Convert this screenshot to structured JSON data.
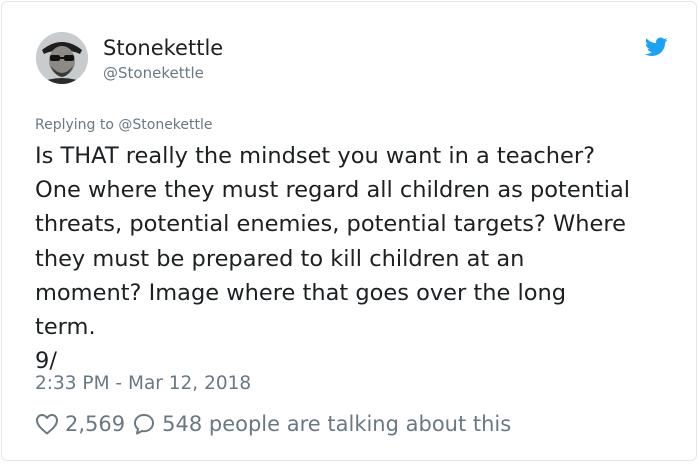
{
  "author": {
    "name": "Stonekettle",
    "handle": "@Stonekettle",
    "avatar_icon": "author-avatar-photo"
  },
  "brand": {
    "icon": "twitter-bird-icon",
    "color": "#1da1f2"
  },
  "tweet": {
    "replying_to": "Replying to @Stonekettle",
    "text": "Is THAT really the mindset you want in a teacher?\nOne where they must regard all children as potential\nthreats, potential enemies, potential targets? Where\nthey must be prepared to kill children at an\nmoment? Image where that goes over the long\nterm.\n9/",
    "timestamp": "2:33 PM - Mar 12, 2018"
  },
  "actions": {
    "like_icon": "heart-icon",
    "like_count": "2,569",
    "reply_icon": "speech-bubble-icon",
    "talking_label": "548 people are talking about this"
  },
  "colors": {
    "text": "#1c2022",
    "secondary_text": "#697882",
    "border": "#e1e8ed"
  }
}
